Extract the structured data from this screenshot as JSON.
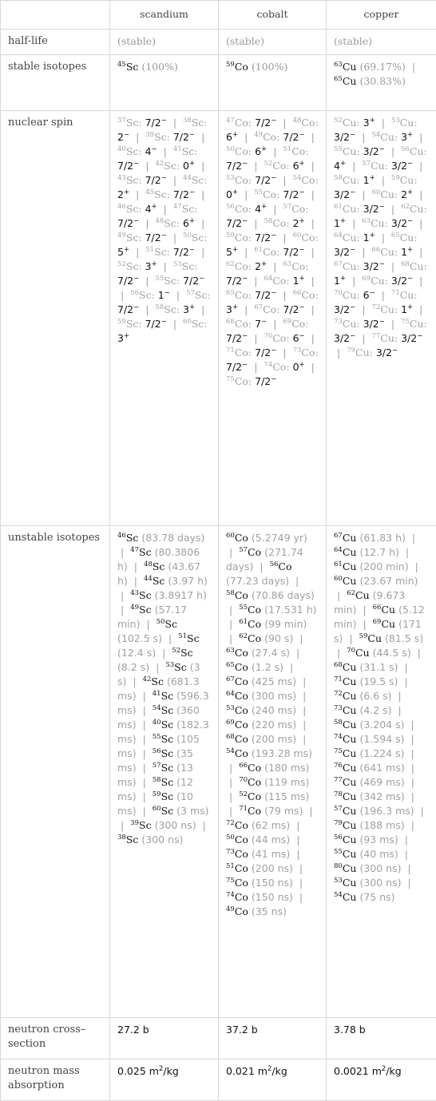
{
  "columns": [
    "",
    "scandium",
    "cobalt",
    "copper"
  ],
  "rows": {
    "half_life": {
      "label": "half-life",
      "values": [
        "(stable)",
        "(stable)",
        "(stable)"
      ]
    },
    "stable_isotopes": {
      "label": "stable isotopes",
      "values": [
        [
          {
            "mass": "45",
            "symbol": "Sc",
            "abundance": "(100%)"
          }
        ],
        [
          {
            "mass": "59",
            "symbol": "Co",
            "abundance": "(100%)"
          }
        ],
        [
          {
            "mass": "63",
            "symbol": "Cu",
            "abundance": "(69.17%)"
          },
          {
            "mass": "65",
            "symbol": "Cu",
            "abundance": "(30.83%)"
          }
        ]
      ]
    },
    "nuclear_spin": {
      "label": "nuclear spin",
      "values": [
        {
          "symbol": "Sc",
          "items": [
            [
              "37",
              "7/2",
              "-"
            ],
            [
              "38",
              "2",
              "-"
            ],
            [
              "39",
              "7/2",
              "-"
            ],
            [
              "40",
              "4",
              "-"
            ],
            [
              "41",
              "7/2",
              "-"
            ],
            [
              "42",
              "0",
              "+"
            ],
            [
              "43",
              "7/2",
              "-"
            ],
            [
              "44",
              "2",
              "+"
            ],
            [
              "45",
              "7/2",
              "-"
            ],
            [
              "46",
              "4",
              "+"
            ],
            [
              "47",
              "7/2",
              "-"
            ],
            [
              "48",
              "6",
              "+"
            ],
            [
              "49",
              "7/2",
              "-"
            ],
            [
              "50",
              "5",
              "+"
            ],
            [
              "51",
              "7/2",
              "-"
            ],
            [
              "52",
              "3",
              "+"
            ],
            [
              "53",
              "7/2",
              "-"
            ],
            [
              "55",
              "7/2",
              "-"
            ],
            [
              "56",
              "1",
              "-"
            ],
            [
              "57",
              "7/2",
              "-"
            ],
            [
              "58",
              "3",
              "+"
            ],
            [
              "59",
              "7/2",
              "-"
            ],
            [
              "60",
              "3",
              "+"
            ]
          ]
        },
        {
          "symbol": "Co",
          "items": [
            [
              "47",
              "7/2",
              "-"
            ],
            [
              "48",
              "6",
              "+"
            ],
            [
              "49",
              "7/2",
              "-"
            ],
            [
              "50",
              "6",
              "+"
            ],
            [
              "51",
              "7/2",
              "-"
            ],
            [
              "52",
              "6",
              "+"
            ],
            [
              "53",
              "7/2",
              "-"
            ],
            [
              "54",
              "0",
              "+"
            ],
            [
              "55",
              "7/2",
              "-"
            ],
            [
              "56",
              "4",
              "+"
            ],
            [
              "57",
              "7/2",
              "-"
            ],
            [
              "58",
              "2",
              "+"
            ],
            [
              "59",
              "7/2",
              "-"
            ],
            [
              "60",
              "5",
              "+"
            ],
            [
              "61",
              "7/2",
              "-"
            ],
            [
              "62",
              "2",
              "+"
            ],
            [
              "63",
              "7/2",
              "-"
            ],
            [
              "64",
              "1",
              "+"
            ],
            [
              "65",
              "7/2",
              "-"
            ],
            [
              "66",
              "3",
              "+"
            ],
            [
              "67",
              "7/2",
              "-"
            ],
            [
              "68",
              "7",
              "-"
            ],
            [
              "69",
              "7/2",
              "-"
            ],
            [
              "70",
              "6",
              "-"
            ],
            [
              "71",
              "7/2",
              "-"
            ],
            [
              "73",
              "7/2",
              "-"
            ],
            [
              "74",
              "0",
              "+"
            ],
            [
              "75",
              "7/2",
              "-"
            ]
          ]
        },
        {
          "symbol": "Cu",
          "items": [
            [
              "52",
              "3",
              "+"
            ],
            [
              "53",
              "3/2",
              "-"
            ],
            [
              "54",
              "3",
              "+"
            ],
            [
              "55",
              "3/2",
              "-"
            ],
            [
              "56",
              "4",
              "+"
            ],
            [
              "57",
              "3/2",
              "-"
            ],
            [
              "58",
              "1",
              "+"
            ],
            [
              "59",
              "3/2",
              "-"
            ],
            [
              "60",
              "2",
              "+"
            ],
            [
              "61",
              "3/2",
              "-"
            ],
            [
              "62",
              "1",
              "+"
            ],
            [
              "63",
              "3/2",
              "-"
            ],
            [
              "64",
              "1",
              "+"
            ],
            [
              "65",
              "3/2",
              "-"
            ],
            [
              "66",
              "1",
              "+"
            ],
            [
              "67",
              "3/2",
              "-"
            ],
            [
              "68",
              "1",
              "+"
            ],
            [
              "69",
              "3/2",
              "-"
            ],
            [
              "70",
              "6",
              "-"
            ],
            [
              "71",
              "3/2",
              "-"
            ],
            [
              "72",
              "1",
              "+"
            ],
            [
              "73",
              "3/2",
              "-"
            ],
            [
              "75",
              "3/2",
              "-"
            ],
            [
              "77",
              "3/2",
              "-"
            ],
            [
              "79",
              "3/2",
              "-"
            ]
          ]
        }
      ]
    },
    "unstable_isotopes": {
      "label": "unstable isotopes",
      "values": [
        {
          "symbol": "Sc",
          "items": [
            [
              "46",
              "83.78 days"
            ],
            [
              "47",
              "80.3806 h"
            ],
            [
              "48",
              "43.67 h"
            ],
            [
              "44",
              "3.97 h"
            ],
            [
              "43",
              "3.8917 h"
            ],
            [
              "49",
              "57.17 min"
            ],
            [
              "50",
              "102.5 s"
            ],
            [
              "51",
              "12.4 s"
            ],
            [
              "52",
              "8.2 s"
            ],
            [
              "53",
              "3 s"
            ],
            [
              "42",
              "681.3 ms"
            ],
            [
              "41",
              "596.3 ms"
            ],
            [
              "54",
              "360 ms"
            ],
            [
              "40",
              "182.3 ms"
            ],
            [
              "55",
              "105 ms"
            ],
            [
              "56",
              "35 ms"
            ],
            [
              "57",
              "13 ms"
            ],
            [
              "58",
              "12 ms"
            ],
            [
              "59",
              "10 ms"
            ],
            [
              "60",
              "3 ms"
            ],
            [
              "39",
              "300 ns"
            ],
            [
              "38",
              "300 ns"
            ]
          ]
        },
        {
          "symbol": "Co",
          "items": [
            [
              "60",
              "5.2749 yr"
            ],
            [
              "57",
              "271.74 days"
            ],
            [
              "56",
              "77.23 days"
            ],
            [
              "58",
              "70.86 days"
            ],
            [
              "55",
              "17.531 h"
            ],
            [
              "61",
              "99 min"
            ],
            [
              "62",
              "90 s"
            ],
            [
              "63",
              "27.4 s"
            ],
            [
              "65",
              "1.2 s"
            ],
            [
              "67",
              "425 ms"
            ],
            [
              "64",
              "300 ms"
            ],
            [
              "53",
              "240 ms"
            ],
            [
              "69",
              "220 ms"
            ],
            [
              "68",
              "200 ms"
            ],
            [
              "54",
              "193.28 ms"
            ],
            [
              "66",
              "180 ms"
            ],
            [
              "70",
              "119 ms"
            ],
            [
              "52",
              "115 ms"
            ],
            [
              "71",
              "79 ms"
            ],
            [
              "72",
              "62 ms"
            ],
            [
              "50",
              "44 ms"
            ],
            [
              "73",
              "41 ms"
            ],
            [
              "51",
              "200 ns"
            ],
            [
              "75",
              "150 ns"
            ],
            [
              "74",
              "150 ns"
            ],
            [
              "49",
              "35 ns"
            ]
          ]
        },
        {
          "symbol": "Cu",
          "items": [
            [
              "67",
              "61.83 h"
            ],
            [
              "64",
              "12.7 h"
            ],
            [
              "61",
              "200 min"
            ],
            [
              "60",
              "23.67 min"
            ],
            [
              "62",
              "9.673 min"
            ],
            [
              "66",
              "5.12 min"
            ],
            [
              "69",
              "171 s"
            ],
            [
              "59",
              "81.5 s"
            ],
            [
              "70",
              "44.5 s"
            ],
            [
              "68",
              "31.1 s"
            ],
            [
              "71",
              "19.5 s"
            ],
            [
              "72",
              "6.6 s"
            ],
            [
              "73",
              "4.2 s"
            ],
            [
              "58",
              "3.204 s"
            ],
            [
              "74",
              "1.594 s"
            ],
            [
              "75",
              "1.224 s"
            ],
            [
              "76",
              "641 ms"
            ],
            [
              "77",
              "469 ms"
            ],
            [
              "78",
              "342 ms"
            ],
            [
              "57",
              "196.3 ms"
            ],
            [
              "79",
              "188 ms"
            ],
            [
              "56",
              "93 ms"
            ],
            [
              "55",
              "40 ms"
            ],
            [
              "80",
              "300 ns"
            ],
            [
              "53",
              "300 ns"
            ],
            [
              "54",
              "75 ns"
            ]
          ]
        }
      ]
    },
    "neutron_cross_section": {
      "label": "neutron cross–section",
      "values": [
        "27.2 b",
        "37.2 b",
        "3.78 b"
      ]
    },
    "neutron_mass_absorption": {
      "label": "neutron mass absorption",
      "values": [
        {
          "number": "0.025",
          "unit": "m",
          "exp": "2",
          "per": "/kg"
        },
        {
          "number": "0.021",
          "unit": "m",
          "exp": "2",
          "per": "/kg"
        },
        {
          "number": "0.0021",
          "unit": "m",
          "exp": "2",
          "per": "/kg"
        }
      ]
    }
  }
}
